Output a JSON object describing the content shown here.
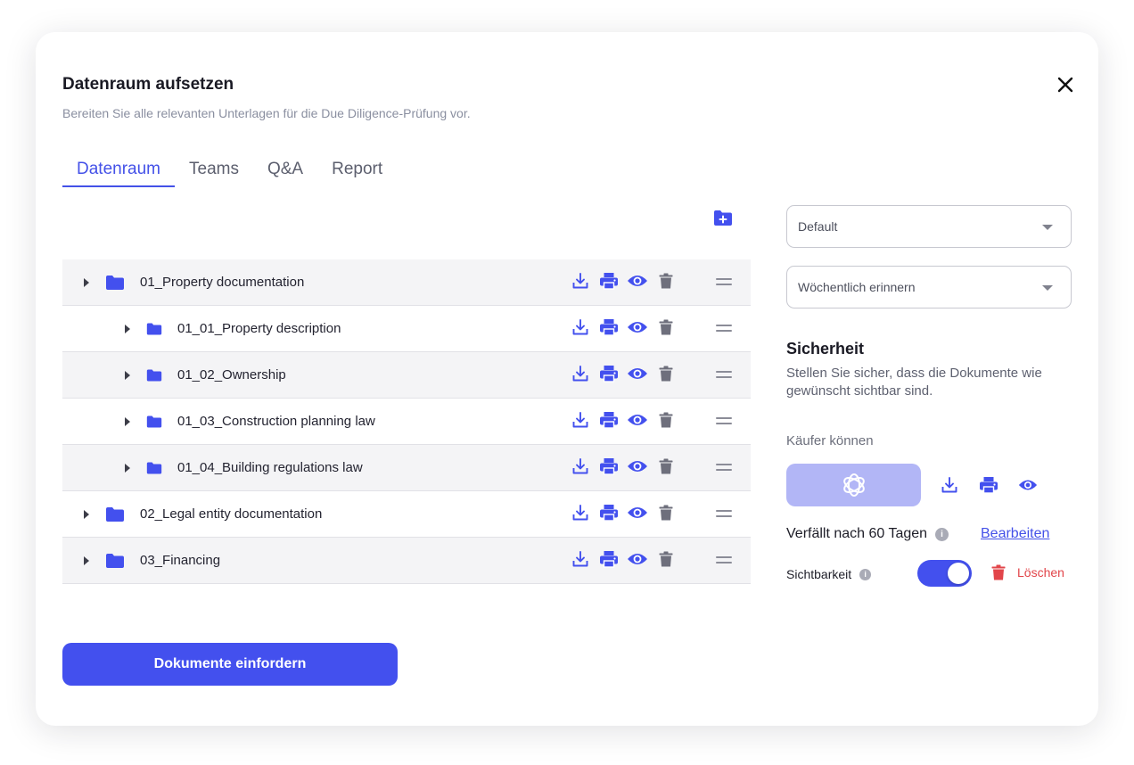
{
  "dialog": {
    "title": "Datenraum aufsetzen",
    "subtitle": "Bereiten Sie alle relevanten Unterlagen für die Due Diligence-Prüfung vor."
  },
  "tabs": [
    {
      "label": "Datenraum",
      "active": true
    },
    {
      "label": "Teams",
      "active": false
    },
    {
      "label": "Q&A",
      "active": false
    },
    {
      "label": "Report",
      "active": false
    }
  ],
  "folders": [
    {
      "label": "01_Property documentation",
      "level": 0
    },
    {
      "label": "01_01_Property description",
      "level": 1
    },
    {
      "label": "01_02_Ownership",
      "level": 1
    },
    {
      "label": "01_03_Construction planning law",
      "level": 1
    },
    {
      "label": "01_04_Building regulations law",
      "level": 1
    },
    {
      "label": "02_Legal entity documentation",
      "level": 0
    },
    {
      "label": "03_Financing",
      "level": 0
    }
  ],
  "primary_button": "Dokumente einfordern",
  "right_panel": {
    "template_select": "Default",
    "reminder_select": "Wöchentlich erinnern",
    "security_title": "Sicherheit",
    "security_desc": "Stellen Sie sicher, dass die Dokumente wie gewünscht sichtbar sind.",
    "buyers_label": "Käufer können",
    "expiry_text": "Verfällt nach 60 Tagen",
    "edit_link": "Bearbeiten",
    "visibility_label": "Sichtbarkeit",
    "visibility_on": true,
    "delete_label": "Löschen"
  },
  "colors": {
    "accent": "#4350ee",
    "icon_grey": "#6e6f7c",
    "danger": "#e2454a",
    "row_shade": "#f4f4f6"
  },
  "icons": {
    "close": "close-icon",
    "add_folder": "folder-plus-icon",
    "folder": "folder-icon",
    "row_actions": [
      "download-icon",
      "print-icon",
      "eye-icon",
      "trash-icon"
    ],
    "drag": "drag-handle-icon",
    "buyers": "openai-logo-icon",
    "info": "info-icon"
  }
}
